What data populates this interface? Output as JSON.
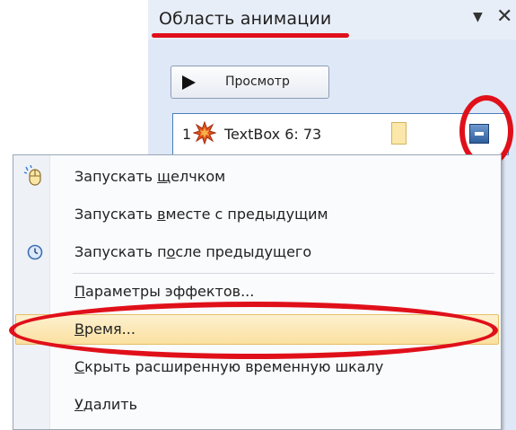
{
  "pane": {
    "title": "Область анимации",
    "dropdown_icon": "triangle-down",
    "close_icon": "x",
    "play_button": {
      "label": "Просмотр",
      "icon": "play-triangle"
    },
    "animation_item": {
      "number": "1",
      "icon": "star-burst",
      "label": "TextBox 6: 73",
      "dropdown_icon": "chevron-down"
    }
  },
  "menu": {
    "items": [
      {
        "id": "start-on-click",
        "pre": "Запускать ",
        "ul": "щ",
        "post": "елчком",
        "icon": "mouse-icon"
      },
      {
        "id": "start-with-previous",
        "pre": "Запускать ",
        "ul": "в",
        "post": "месте с предыдущим",
        "icon": ""
      },
      {
        "id": "start-after-previous",
        "pre": "Запускать п",
        "ul": "о",
        "post": "сле предыдущего",
        "icon": "clock-icon"
      },
      {
        "id": "effect-options",
        "pre": "",
        "ul": "П",
        "post": "араметры эффектов...",
        "icon": ""
      },
      {
        "id": "timing",
        "pre": "",
        "ul": "В",
        "post": "ремя...",
        "icon": "",
        "highlighted": true
      },
      {
        "id": "hide-advanced-timeline",
        "pre": "",
        "ul": "С",
        "post": "крыть расширенную временную шкалу",
        "icon": ""
      },
      {
        "id": "remove",
        "pre": "",
        "ul": "У",
        "post": "далить",
        "icon": ""
      }
    ]
  },
  "annotation_color": "#e0101a",
  "highlight_color": "#fbe0a0",
  "accent_color": "#2e5f9e"
}
